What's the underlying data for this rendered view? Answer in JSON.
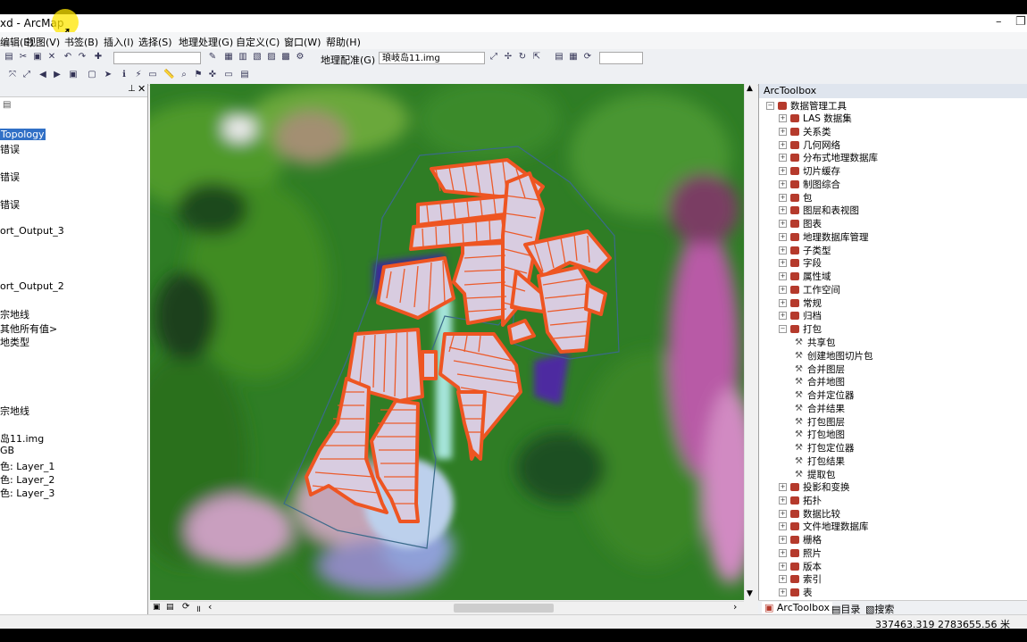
{
  "window": {
    "title": "xd - ArcMap",
    "controls": [
      "–",
      "❐"
    ]
  },
  "menu": [
    "编辑(E)",
    "视图(V)",
    "书签(B)",
    "插入(I)",
    "选择(S)",
    "地理处理(G)",
    "自定义(C)",
    "窗口(W)",
    "帮助(H)"
  ],
  "toolbar": {
    "georef_label": "地理配准(G)",
    "layer_value": "琅岐岛11.img"
  },
  "toc": {
    "items": [
      "Topology",
      "错误",
      "错误",
      "错误",
      "ort_Output_3",
      "ort_Output_2",
      "宗地线",
      "其他所有值>",
      "地类型",
      "宗地线",
      "岛11.img",
      "GB",
      "色: Layer_1",
      "色: Layer_2",
      "色: Layer_3"
    ]
  },
  "toolbox": {
    "title": "ArcToolbox",
    "root": "数据管理工具",
    "groups_top": [
      "LAS 数据集",
      "关系类",
      "几何网络",
      "分布式地理数据库",
      "切片缓存",
      "制图综合",
      "包",
      "图层和表视图",
      "图表",
      "地理数据库管理",
      "子类型",
      "字段",
      "属性域",
      "工作空间",
      "常规",
      "归档"
    ],
    "expanded_group": "打包",
    "tools": [
      "共享包",
      "创建地图切片包",
      "合并图层",
      "合并地图",
      "合并定位器",
      "合并结果",
      "打包图层",
      "打包地图",
      "打包定位器",
      "打包结果",
      "提取包"
    ],
    "groups_bottom": [
      "投影和变换",
      "拓扑",
      "数据比较",
      "文件地理数据库",
      "栅格",
      "照片",
      "版本",
      "索引",
      "表"
    ]
  },
  "tabs": [
    "ArcToolbox",
    "目录",
    "搜索"
  ],
  "status": {
    "coords": "337463.319  2783655.56 米"
  },
  "colors": {
    "parcel_fill": "#d8cce0",
    "parcel_stroke": "#ee5522",
    "selection": "#3170c6",
    "boundary": "#3a6a8a"
  }
}
